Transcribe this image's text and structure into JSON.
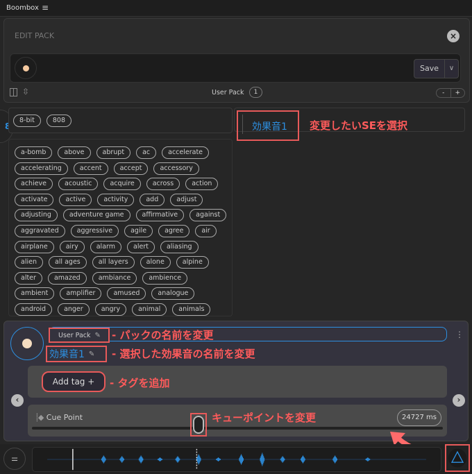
{
  "app": {
    "title": "Boombox",
    "menu_icon": "hamburger-icon"
  },
  "edit_pack": {
    "title": "EDIT PACK",
    "save_label": "Save",
    "pack_name": "User Pack",
    "pack_count": "1",
    "zoom_minus": "-",
    "zoom_plus": "+"
  },
  "side_badge": "8",
  "categories": [
    "8-bit",
    "808"
  ],
  "tags": [
    "a-bomb",
    "above",
    "abrupt",
    "ac",
    "accelerate",
    "accelerating",
    "accent",
    "accept",
    "accessory",
    "achieve",
    "acoustic",
    "acquire",
    "across",
    "action",
    "activate",
    "active",
    "activity",
    "add",
    "adjust",
    "adjusting",
    "adventure game",
    "affirmative",
    "against",
    "aggravated",
    "aggressive",
    "agile",
    "agree",
    "air",
    "airplane",
    "airy",
    "alarm",
    "alert",
    "aliasing",
    "alien",
    "all ages",
    "all layers",
    "alone",
    "alpine",
    "alter",
    "amazed",
    "ambiance",
    "ambience",
    "ambient",
    "amplifier",
    "amused",
    "analogue",
    "android",
    "anger",
    "angry",
    "animal",
    "animals"
  ],
  "sound_list": [
    {
      "name": "効果音1",
      "selected": true
    }
  ],
  "detail": {
    "pack_name": "User Pack",
    "sound_name": "効果音1",
    "add_tag": "Add tag +",
    "cue_label": "Cue Point",
    "cue_value": "24727 ms"
  },
  "annotations": {
    "select_se": "変更したいSEを選択",
    "rename_pack": "パックの名前を変更",
    "rename_se": "選択した効果音の名前を変更",
    "add_tag": "タグを追加",
    "cue": "キューポイントを変更"
  },
  "colors": {
    "accent": "#2d8fe0",
    "annotation": "#e85a5a"
  }
}
